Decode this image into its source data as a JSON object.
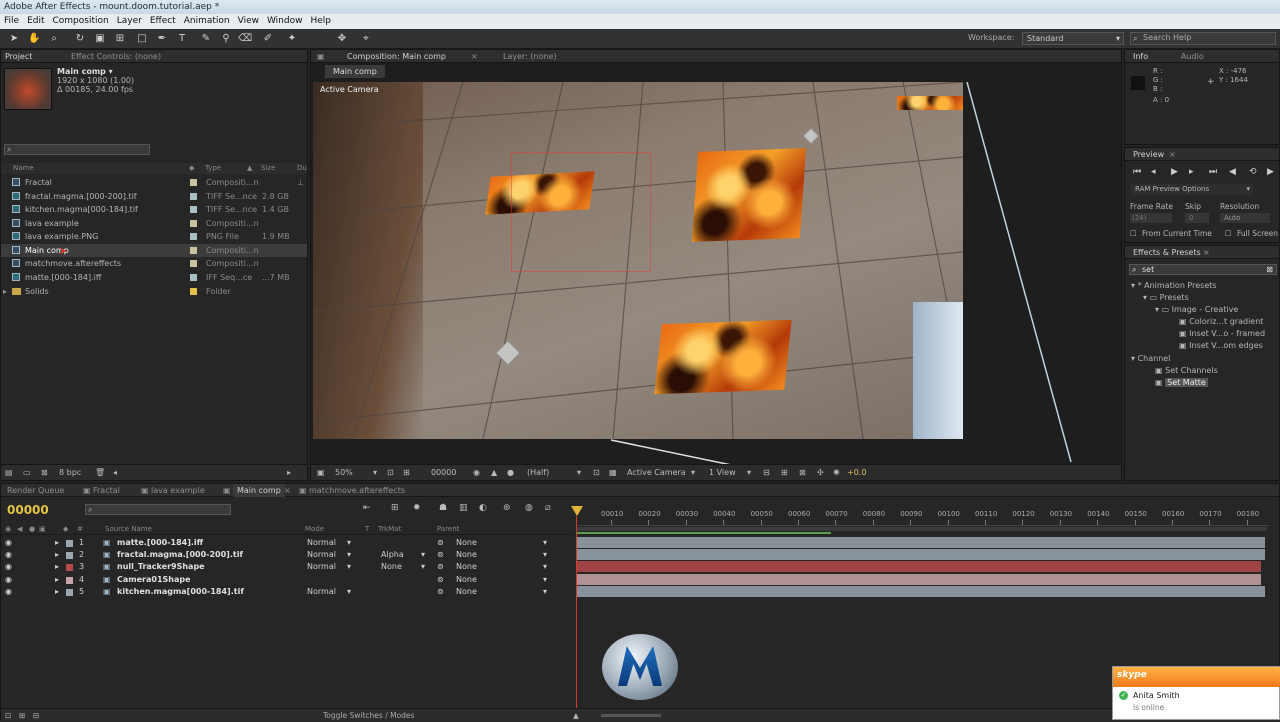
{
  "window": {
    "title": "Adobe After Effects - mount.doom.tutorial.aep *"
  },
  "menu": [
    "File",
    "Edit",
    "Composition",
    "Layer",
    "Effect",
    "Animation",
    "View",
    "Window",
    "Help"
  ],
  "toolbar": {
    "workspace_label": "Workspace:",
    "workspace_value": "Standard",
    "search_help_placeholder": "Search Help"
  },
  "project": {
    "tabs": [
      "Project",
      "Effect Controls: (none)"
    ],
    "selected_name": "Main comp ▾",
    "selected_info1": "1920 x 1080 (1.00)",
    "selected_info2": "Δ 00185, 24.00 fps",
    "columns": {
      "name": "Name",
      "type": "Type",
      "size": "Size",
      "dur": "Du"
    },
    "items": [
      {
        "name": "Fractal",
        "type": "Compositi...n",
        "size": ""
      },
      {
        "name": "fractal.magma.[000-200].tif",
        "type": "TIFF Se...nce",
        "size": "2.8 GB"
      },
      {
        "name": "kitchen.magma[000-184].tif",
        "type": "TIFF Se...nce",
        "size": "1.4 GB"
      },
      {
        "name": "lava example",
        "type": "Compositi...n",
        "size": ""
      },
      {
        "name": "lava example.PNG",
        "type": "PNG File",
        "size": "1.9 MB"
      },
      {
        "name": "Main comp",
        "type": "Compositi...n",
        "size": ""
      },
      {
        "name": "matchmove.aftereffects",
        "type": "Compositi...n",
        "size": ""
      },
      {
        "name": "matte.[000-184].iff",
        "type": "IFF Seq...ce",
        "size": "...7 MB"
      },
      {
        "name": "Solids",
        "type": "Folder",
        "size": ""
      }
    ],
    "bpc": "8 bpc"
  },
  "composition": {
    "tabs": [
      "Composition: Main comp",
      "Layer: (none)"
    ],
    "subtab": "Main comp",
    "camera_label": "Active Camera",
    "footer": {
      "zoom": "50%",
      "timecode": "00000",
      "resolution": "(Half)",
      "camera": "Active Camera",
      "view": "1 View",
      "exposure": "+0.0"
    }
  },
  "info": {
    "tabs": [
      "Info",
      "Audio"
    ],
    "r": "R :",
    "g": "G :",
    "b": "B :",
    "a": "A : 0",
    "x": "X : -476",
    "y": "Y : 1644"
  },
  "preview": {
    "tab": "Preview",
    "ram_options": "RAM Preview Options",
    "frame_rate_label": "Frame Rate",
    "skip_label": "Skip",
    "resolution_label": "Resolution",
    "frame_rate_value": "(24)",
    "skip_value": "0",
    "resolution_value": "Auto",
    "from_current": "From Current Time",
    "full_screen": "Full Screen"
  },
  "effects": {
    "tab": "Effects & Presets",
    "search_value": "set",
    "tree": [
      {
        "label": "* Animation Presets",
        "indent": 0
      },
      {
        "label": "Presets",
        "indent": 1
      },
      {
        "label": "Image - Creative",
        "indent": 2
      },
      {
        "label": "Coloriz...t gradient",
        "indent": 3
      },
      {
        "label": "Inset V...o - framed",
        "indent": 3
      },
      {
        "label": "Inset V...om edges",
        "indent": 3
      },
      {
        "label": "Channel",
        "indent": 0
      },
      {
        "label": "Set Channels",
        "indent": 1
      },
      {
        "label": "Set Matte",
        "indent": 1
      }
    ]
  },
  "timeline": {
    "tabs": [
      "Render Queue",
      "Fractal",
      "lava example",
      "Main comp",
      "matchmove.aftereffects"
    ],
    "timecode": "00000",
    "columns": {
      "source": "Source Name",
      "mode": "Mode",
      "t": "T",
      "trkmat": "TrkMat",
      "parent": "Parent"
    },
    "ruler": [
      "00010",
      "00020",
      "00030",
      "00040",
      "00050",
      "00060",
      "00070",
      "00080",
      "00090",
      "00100",
      "00110",
      "00120",
      "00130",
      "00140",
      "00150",
      "00160",
      "00170",
      "00180"
    ],
    "layers": [
      {
        "num": "1",
        "name": "matte.[000-184].iff",
        "mode": "Normal",
        "trkmat": "",
        "parent": "None",
        "color": "#9aa6b0"
      },
      {
        "num": "2",
        "name": "fractal.magma.[000-200].tif",
        "mode": "Normal",
        "trkmat": "Alpha",
        "parent": "None",
        "color": "#9aa6b0"
      },
      {
        "num": "3",
        "name": "null_Tracker9Shape",
        "mode": "Normal",
        "trkmat": "None",
        "parent": "None",
        "color": "#b44a4a"
      },
      {
        "num": "4",
        "name": "Camera01Shape",
        "mode": "",
        "trkmat": "",
        "parent": "None",
        "color": "#c9a4a8"
      },
      {
        "num": "5",
        "name": "kitchen.magma[000-184].tif",
        "mode": "Normal",
        "trkmat": "",
        "parent": "None",
        "color": "#9aa6b0"
      }
    ],
    "toggle_label": "Toggle Switches / Modes"
  },
  "notification": {
    "app": "skype",
    "name": "Anita Smith",
    "status": "is online"
  }
}
